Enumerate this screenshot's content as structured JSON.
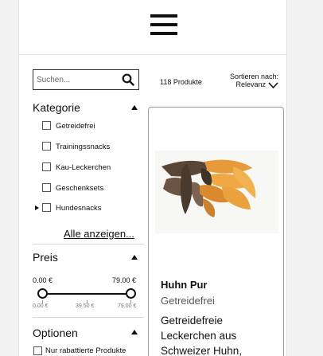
{
  "header": {
    "menu_icon": "hamburger-menu-icon"
  },
  "search": {
    "placeholder": "Suchen...",
    "icon": "search-icon"
  },
  "results": {
    "count_label": "118 Produkte"
  },
  "sort": {
    "label": "Sortieren nach:",
    "value": "Relevanz"
  },
  "category": {
    "title": "Kategorie",
    "items": [
      {
        "label": "Getreidefrei",
        "checked": false
      },
      {
        "label": "Trainingssnacks",
        "checked": false
      },
      {
        "label": "Kau-Leckerchen",
        "checked": false
      },
      {
        "label": "Geschenksets",
        "checked": false
      },
      {
        "label": "Hundesnacks",
        "checked": false,
        "expandable": true
      }
    ],
    "show_all": "Alle anzeigen..."
  },
  "price": {
    "title": "Preis",
    "min_value": "0.00 €",
    "max_value": "79.00 €",
    "tick_min": "0.00 €",
    "tick_mid": "39.50 €",
    "tick_max": "79.00 €"
  },
  "options": {
    "title": "Optionen",
    "items": [
      {
        "label": "Nur rabattierte Produkte",
        "checked": false
      }
    ]
  },
  "product": {
    "title": "Huhn Pur",
    "subtitle": "Getreidefrei",
    "description": "Getreidefreie Leckerchen aus Schweizer Huhn,"
  },
  "colors": {
    "accent": "#111111",
    "card_border": "#999999",
    "meat_orange": "#e69a3a",
    "meat_dark": "#5a4636"
  }
}
